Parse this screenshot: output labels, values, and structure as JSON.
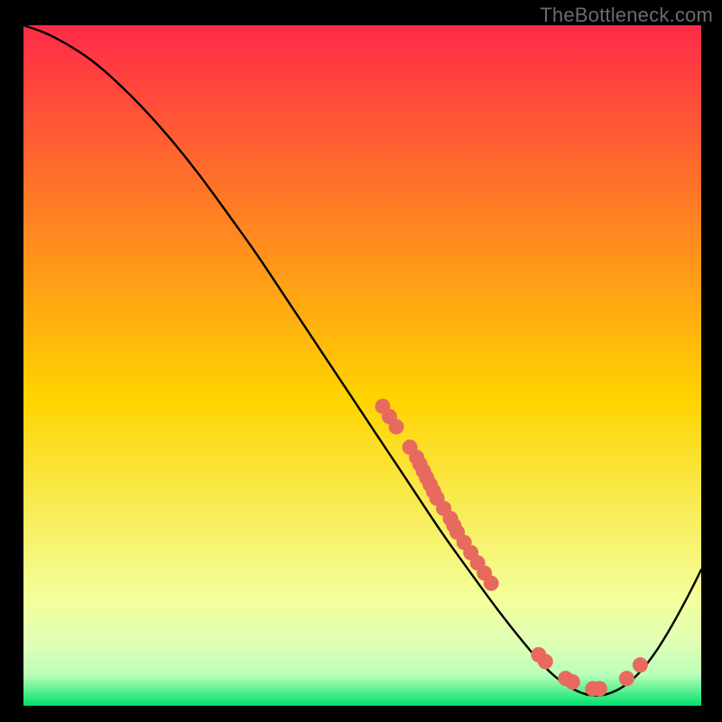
{
  "watermark": "TheBottleneck.com",
  "colors": {
    "background": "#000000",
    "curve": "#000000",
    "dots": "#e86a5e",
    "grad_top": "#ff2a48",
    "grad_mid": "#ffd400",
    "grad_low1": "#f3ff9a",
    "grad_low2": "#dfffb6",
    "grad_low3": "#b9ffb9",
    "grad_bottom": "#00e06a"
  },
  "chart_data": {
    "type": "line",
    "title": "",
    "xlabel": "",
    "ylabel": "",
    "xlim": [
      0,
      100
    ],
    "ylim": [
      0,
      100
    ],
    "series": [
      {
        "name": "bottleneck-curve",
        "x": [
          0,
          3,
          6,
          10,
          14,
          18,
          22,
          26,
          30,
          34,
          38,
          42,
          46,
          50,
          54,
          58,
          62,
          66,
          70,
          74,
          77,
          80,
          83,
          86,
          89,
          92,
          95,
          98,
          100
        ],
        "y": [
          100,
          99,
          97.5,
          95,
          91.5,
          87.5,
          83,
          78,
          72.5,
          67,
          61,
          55,
          49,
          43,
          37,
          31,
          25,
          19.5,
          14,
          9,
          5.5,
          3,
          1.5,
          1.5,
          3,
          6,
          10.5,
          16,
          20
        ]
      }
    ],
    "scatter": [
      {
        "name": "markers",
        "points": [
          {
            "x": 53,
            "y": 44
          },
          {
            "x": 54,
            "y": 42.5
          },
          {
            "x": 55,
            "y": 41
          },
          {
            "x": 57,
            "y": 38
          },
          {
            "x": 58,
            "y": 36.5
          },
          {
            "x": 58.5,
            "y": 35.5
          },
          {
            "x": 59,
            "y": 34.5
          },
          {
            "x": 59.5,
            "y": 33.5
          },
          {
            "x": 60,
            "y": 32.5
          },
          {
            "x": 60.5,
            "y": 31.5
          },
          {
            "x": 61,
            "y": 30.5
          },
          {
            "x": 62,
            "y": 29
          },
          {
            "x": 63,
            "y": 27.5
          },
          {
            "x": 63.5,
            "y": 26.5
          },
          {
            "x": 64,
            "y": 25.5
          },
          {
            "x": 65,
            "y": 24
          },
          {
            "x": 66,
            "y": 22.5
          },
          {
            "x": 67,
            "y": 21
          },
          {
            "x": 68,
            "y": 19.5
          },
          {
            "x": 69,
            "y": 18
          },
          {
            "x": 76,
            "y": 7.5
          },
          {
            "x": 77,
            "y": 6.5
          },
          {
            "x": 80,
            "y": 4
          },
          {
            "x": 81,
            "y": 3.5
          },
          {
            "x": 84,
            "y": 2.5
          },
          {
            "x": 85,
            "y": 2.5
          },
          {
            "x": 89,
            "y": 4
          },
          {
            "x": 91,
            "y": 6
          }
        ]
      }
    ]
  }
}
